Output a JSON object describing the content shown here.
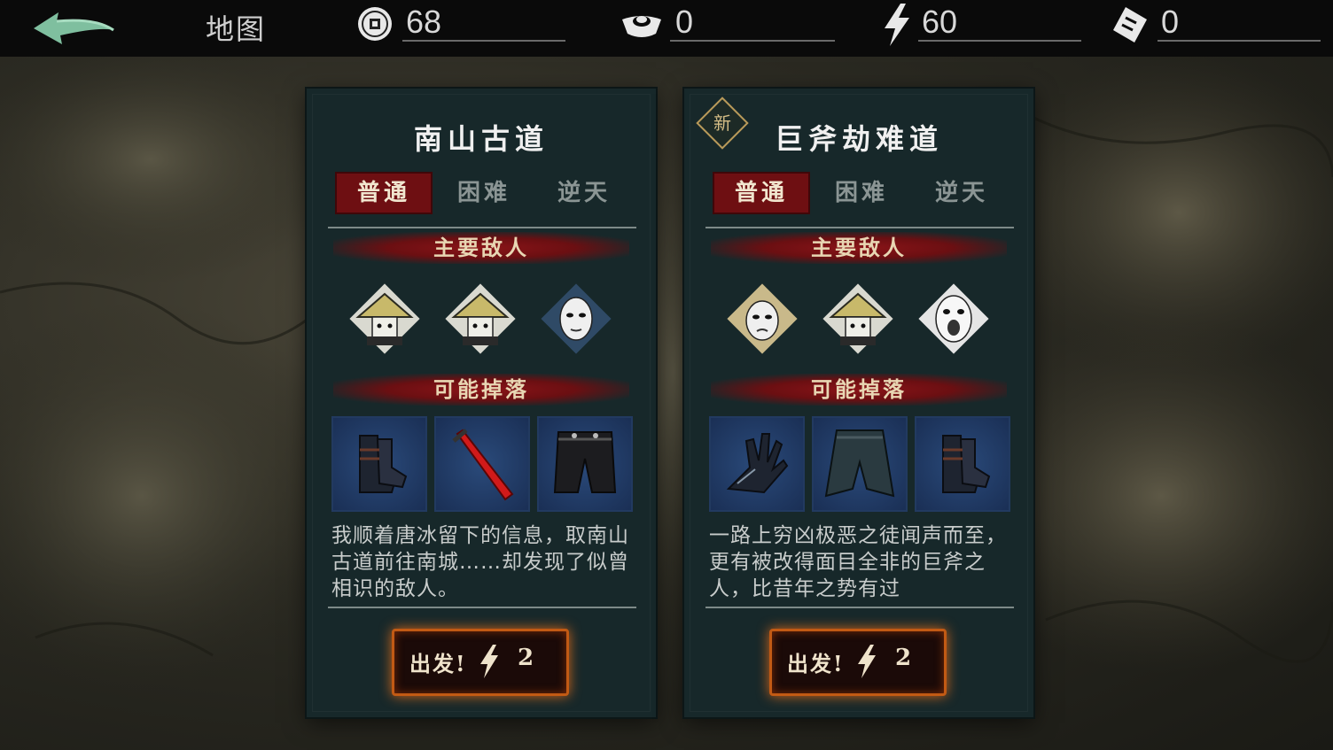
{
  "header": {
    "title": "地图",
    "resources": [
      {
        "name": "coin",
        "icon": "copper-coin-icon",
        "value": "68"
      },
      {
        "name": "ingot",
        "icon": "silver-ingot-icon",
        "value": "0"
      },
      {
        "name": "energy",
        "icon": "lightning-icon",
        "value": "60"
      },
      {
        "name": "ticket",
        "icon": "ticket-icon",
        "value": "0"
      }
    ]
  },
  "cards": [
    {
      "title": "南山古道",
      "is_new": false,
      "tabs": [
        "普通",
        "困难",
        "逆天"
      ],
      "active_tab": "普通",
      "enemies_label": "主要敌人",
      "enemies": [
        "straw-hat-bandit-icon",
        "straw-hat-bandit-icon",
        "hooded-mask-icon"
      ],
      "drops_label": "可能掉落",
      "drops": [
        "boots-icon",
        "red-blade-icon",
        "pants-icon"
      ],
      "description": "我顺着唐冰留下的信息，取南山古道前往南城……却发现了似曾相识的敌人。",
      "button_label": "出发!",
      "cost": "2"
    },
    {
      "title": "巨斧劫难道",
      "is_new": true,
      "new_label": "新",
      "tabs": [
        "普通",
        "困难",
        "逆天"
      ],
      "active_tab": "普通",
      "enemies_label": "主要敌人",
      "enemies": [
        "hooded-mask-icon",
        "straw-hat-bandit-icon",
        "screaming-mask-icon"
      ],
      "drops_label": "可能掉落",
      "drops": [
        "gauntlet-icon",
        "cloak-pants-icon",
        "boots-icon"
      ],
      "description": "一路上穷凶极恶之徒闻声而至，更有被改得面目全非的巨斧之人，比昔年之势有过",
      "button_label": "出发!",
      "cost": "2"
    }
  ],
  "colors": {
    "card_bg": "#17282a",
    "tab_active": "#6e0f12",
    "banner": "#8a1418",
    "button_glow": "#d3661b",
    "back_arrow": "#7fbf9f"
  }
}
